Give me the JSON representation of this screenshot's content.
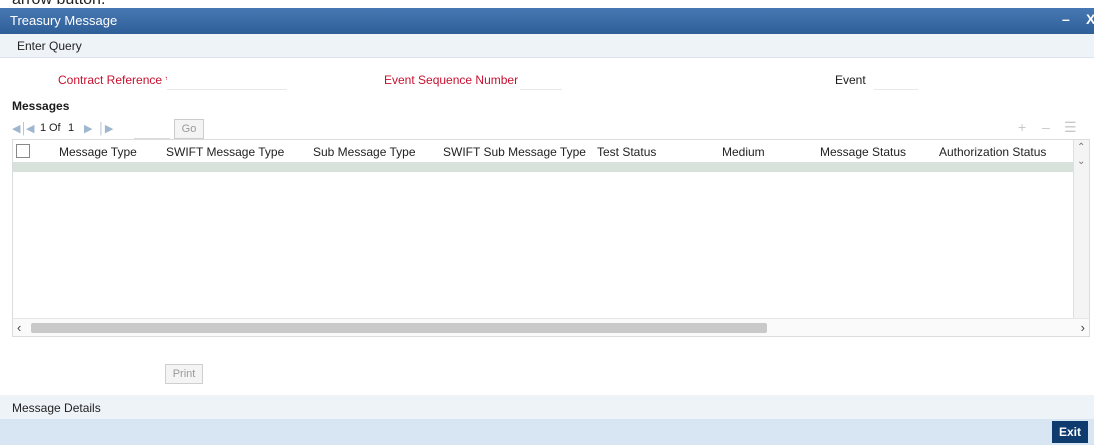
{
  "top_text": "arrow button.",
  "window": {
    "title": "Treasury Message",
    "minimize": "–",
    "close": "X"
  },
  "toolbar": {
    "enter_query": "Enter Query"
  },
  "form": {
    "contract_reference_label": "Contract Reference *",
    "contract_reference_value": "",
    "event_seq_label": "Event Sequence Number *",
    "event_seq_value": "",
    "event_label": "Event",
    "event_value": ""
  },
  "messages": {
    "title": "Messages",
    "pager": {
      "current": "1",
      "of_label": "Of",
      "total": "1",
      "page_input": "",
      "go_label": "Go"
    },
    "columns": [
      "Message Type",
      "SWIFT Message Type",
      "Sub Message Type",
      "SWIFT Sub Message Type",
      "Test Status",
      "Medium",
      "Message Status",
      "Authorization Status"
    ],
    "rows": []
  },
  "print_label": "Print",
  "details": {
    "label": "Message Details"
  },
  "footer": {
    "exit_label": "Exit"
  },
  "colors": {
    "title_bar": "#3a6ea8",
    "required_label": "#c8102e",
    "exit_button": "#0f3b6f",
    "footer": "#d8e6f3"
  }
}
